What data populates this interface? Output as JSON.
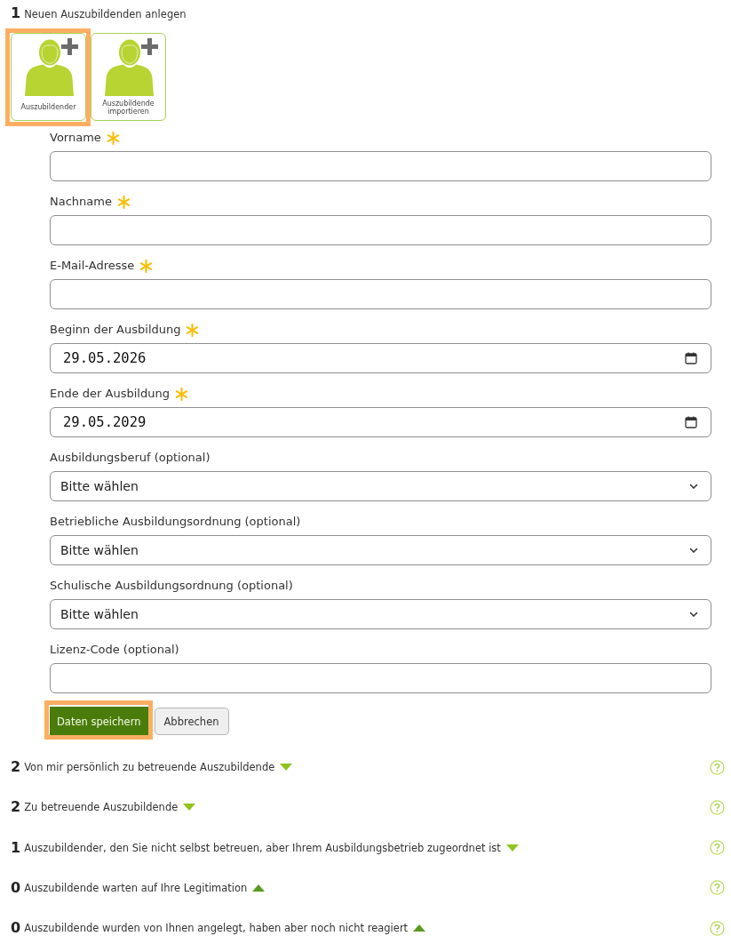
{
  "create_section": {
    "count": "1",
    "title": "Neuen Auszubildenden anlegen"
  },
  "tiles": [
    {
      "label": "Auszubildender",
      "highlighted": true
    },
    {
      "label": "Auszubildende importieren",
      "highlighted": false
    }
  ],
  "fields": [
    {
      "kind": "text",
      "label": "Vorname",
      "required": true
    },
    {
      "kind": "text",
      "label": "Nachname",
      "required": true
    },
    {
      "kind": "text",
      "label": "E-Mail-Adresse",
      "required": true
    },
    {
      "kind": "date",
      "label": "Beginn der Ausbildung",
      "required": true,
      "value": "29.05.2026"
    },
    {
      "kind": "date",
      "label": "Ende der Ausbildung",
      "required": true,
      "value": "29.05.2029"
    },
    {
      "kind": "select",
      "label": "Ausbildungsberuf (optional)",
      "required": false,
      "value": "Bitte wählen"
    },
    {
      "kind": "select",
      "label": "Betriebliche Ausbildungsordnung (optional)",
      "required": false,
      "value": "Bitte wählen"
    },
    {
      "kind": "select",
      "label": "Schulische Ausbildungsordnung (optional)",
      "required": false,
      "value": "Bitte wählen"
    },
    {
      "kind": "text",
      "label": "Lizenz-Code (optional)",
      "required": false
    }
  ],
  "buttons": [
    {
      "kind": "primary",
      "label": "Daten speichern",
      "highlighted": true
    },
    {
      "kind": "secondary",
      "label": "Abbrechen",
      "highlighted": false
    }
  ],
  "sections": [
    {
      "count": "2",
      "title": "Von mir persönlich zu betreuende Auszubildende",
      "expanded": false
    },
    {
      "count": "2",
      "title": "Zu betreuende Auszubildende",
      "expanded": false
    },
    {
      "count": "1",
      "title": "Auszubildender, den Sie nicht selbst betreuen, aber Ihrem Ausbildungsbetrieb zugeordnet ist",
      "expanded": false
    },
    {
      "count": "0",
      "title": "Auszubildende warten auf Ihre Legitimation",
      "expanded": true
    },
    {
      "count": "0",
      "title": "Auszubildende wurden von Ihnen angelegt, haben aber noch nicht reagiert",
      "expanded": true
    }
  ]
}
